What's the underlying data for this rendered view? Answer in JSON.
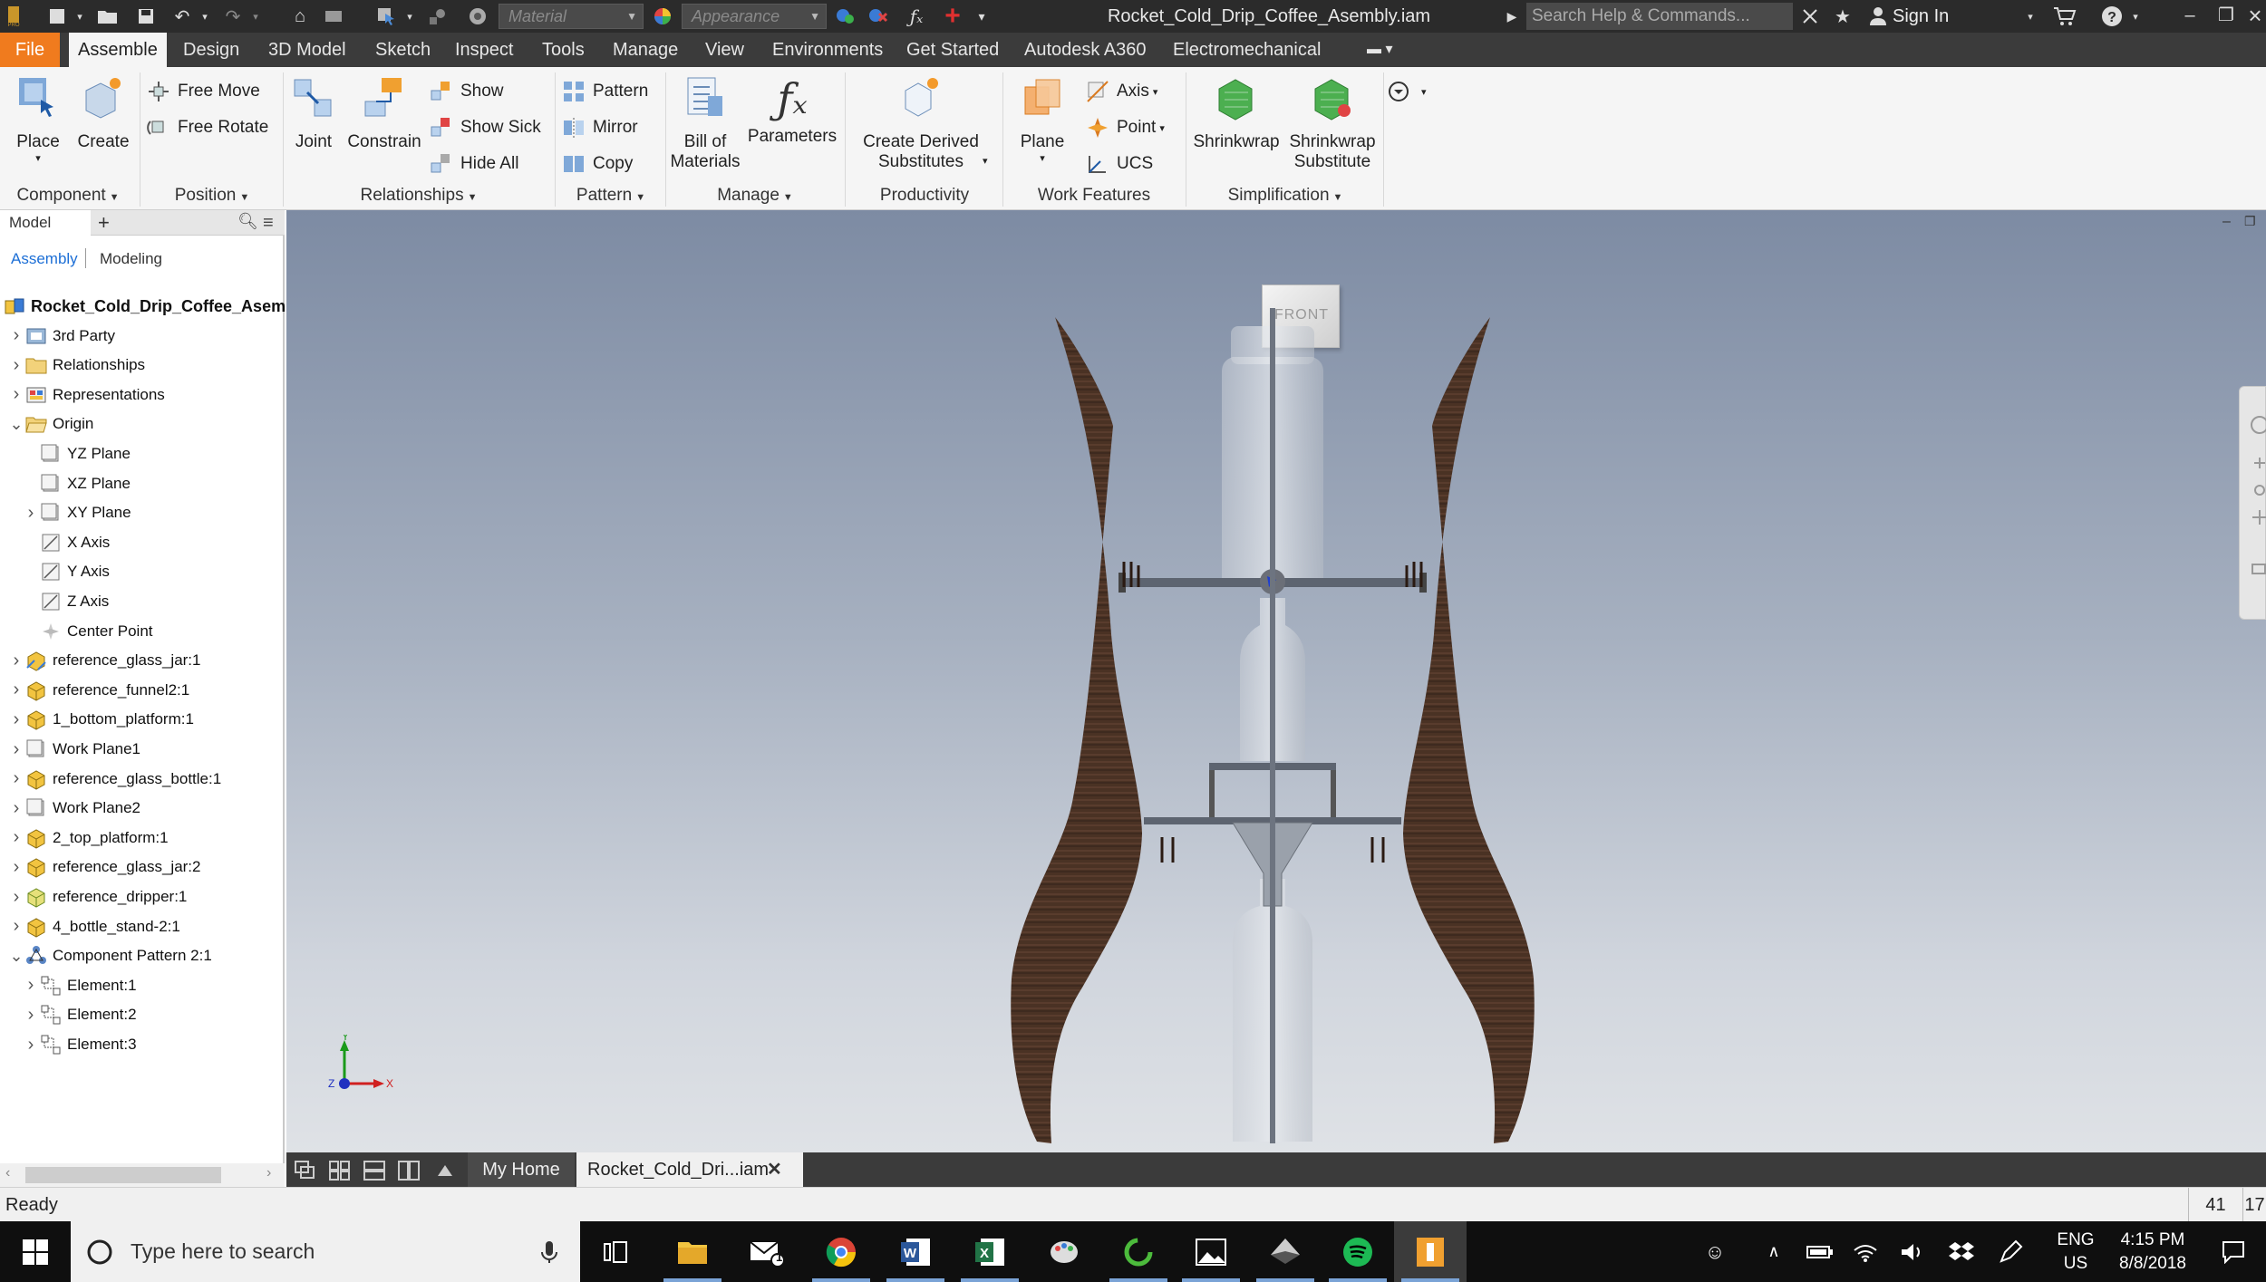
{
  "titlebar": {
    "document_title": "Rocket_Cold_Drip_Coffee_Asembly.iam",
    "material_placeholder": "Material",
    "appearance_placeholder": "Appearance",
    "search_placeholder": "Search Help & Commands...",
    "sign_in": "Sign In",
    "icons": [
      "new-icon",
      "open-icon",
      "save-icon",
      "undo-icon",
      "redo-icon",
      "home-icon",
      "return-icon",
      "select-icon",
      "update-icon",
      "color-wheel-icon",
      "adjust-icon",
      "clear-override-icon",
      "fx-icon",
      "add-icon",
      "customize-icon",
      "cart-icon",
      "help-icon",
      "minimize-icon",
      "restore-icon",
      "close-icon"
    ]
  },
  "menu": {
    "tabs": [
      "File",
      "Assemble",
      "Design",
      "3D Model",
      "Sketch",
      "Inspect",
      "Tools",
      "Manage",
      "View",
      "Environments",
      "Get Started",
      "Autodesk A360",
      "Electromechanical"
    ],
    "active": "Assemble"
  },
  "ribbon": {
    "component": {
      "label": "Component",
      "place": "Place",
      "create": "Create"
    },
    "position": {
      "label": "Position",
      "free_move": "Free Move",
      "free_rotate": "Free Rotate"
    },
    "relationships": {
      "label": "Relationships",
      "joint": "Joint",
      "constrain": "Constrain",
      "show": "Show",
      "show_sick": "Show Sick",
      "hide_all": "Hide All"
    },
    "pattern": {
      "label": "Pattern",
      "pattern": "Pattern",
      "mirror": "Mirror",
      "copy": "Copy"
    },
    "manage": {
      "label": "Manage",
      "bom_1": "Bill of",
      "bom_2": "Materials",
      "parameters": "Parameters"
    },
    "productivity": {
      "label": "Productivity",
      "derived_1": "Create Derived",
      "derived_2": "Substitutes"
    },
    "work_features": {
      "label": "Work Features",
      "plane": "Plane",
      "axis": "Axis",
      "point": "Point",
      "ucs": "UCS"
    },
    "simplification": {
      "label": "Simplification",
      "shrinkwrap": "Shrinkwrap",
      "shrinkwrap_sub_1": "Shrinkwrap",
      "shrinkwrap_sub_2": "Substitute"
    }
  },
  "browser": {
    "tab": "Model",
    "modes": [
      "Assembly",
      "Modeling"
    ],
    "tree": [
      {
        "label": "Rocket_Cold_Drip_Coffee_Asembly.iam",
        "indent": 0,
        "expander": "",
        "icon": "assembly-icon",
        "root": true
      },
      {
        "label": "3rd Party",
        "indent": 1,
        "expander": "collapsed",
        "icon": "third-party-icon"
      },
      {
        "label": "Relationships",
        "indent": 1,
        "expander": "collapsed",
        "icon": "folder-icon"
      },
      {
        "label": "Representations",
        "indent": 1,
        "expander": "collapsed",
        "icon": "representations-icon"
      },
      {
        "label": "Origin",
        "indent": 1,
        "expander": "expanded",
        "icon": "folder-open-icon"
      },
      {
        "label": "YZ Plane",
        "indent": 2,
        "expander": "",
        "icon": "plane-icon"
      },
      {
        "label": "XZ Plane",
        "indent": 2,
        "expander": "",
        "icon": "plane-icon"
      },
      {
        "label": "XY Plane",
        "indent": 2,
        "expander": "collapsed",
        "icon": "plane-icon"
      },
      {
        "label": "X Axis",
        "indent": 2,
        "expander": "",
        "icon": "axis-icon"
      },
      {
        "label": "Y Axis",
        "indent": 2,
        "expander": "",
        "icon": "axis-icon"
      },
      {
        "label": "Z Axis",
        "indent": 2,
        "expander": "",
        "icon": "axis-icon"
      },
      {
        "label": "Center Point",
        "indent": 2,
        "expander": "",
        "icon": "center-point-icon"
      },
      {
        "label": "reference_glass_jar:1",
        "indent": 1,
        "expander": "collapsed",
        "icon": "part-grounded-icon"
      },
      {
        "label": "reference_funnel2:1",
        "indent": 1,
        "expander": "collapsed",
        "icon": "part-icon"
      },
      {
        "label": "1_bottom_platform:1",
        "indent": 1,
        "expander": "collapsed",
        "icon": "part-icon"
      },
      {
        "label": "Work Plane1",
        "indent": 1,
        "expander": "collapsed",
        "icon": "work-plane-icon"
      },
      {
        "label": "reference_glass_bottle:1",
        "indent": 1,
        "expander": "collapsed",
        "icon": "part-icon"
      },
      {
        "label": "Work Plane2",
        "indent": 1,
        "expander": "collapsed",
        "icon": "work-plane-icon"
      },
      {
        "label": "2_top_platform:1",
        "indent": 1,
        "expander": "collapsed",
        "icon": "part-icon"
      },
      {
        "label": "reference_glass_jar:2",
        "indent": 1,
        "expander": "collapsed",
        "icon": "part-icon"
      },
      {
        "label": "reference_dripper:1",
        "indent": 1,
        "expander": "collapsed",
        "icon": "part-green-icon"
      },
      {
        "label": "4_bottle_stand-2:1",
        "indent": 1,
        "expander": "collapsed",
        "icon": "part-icon"
      },
      {
        "label": "Component Pattern 2:1",
        "indent": 1,
        "expander": "expanded",
        "icon": "component-pattern-icon"
      },
      {
        "label": "Element:1",
        "indent": 2,
        "expander": "collapsed",
        "icon": "element-icon"
      },
      {
        "label": "Element:2",
        "indent": 2,
        "expander": "collapsed",
        "icon": "element-icon"
      },
      {
        "label": "Element:3",
        "indent": 2,
        "expander": "collapsed",
        "icon": "element-icon"
      }
    ]
  },
  "viewport": {
    "viewcube_label": "FRONT",
    "triad": {
      "x": "X",
      "y": "Y",
      "z": "Z"
    }
  },
  "doc_tabs": {
    "home": "My Home",
    "document": "Rocket_Cold_Dri...iam",
    "close": "✕"
  },
  "status": {
    "text": "Ready",
    "n1": "41",
    "n2": "17"
  },
  "taskbar": {
    "search_placeholder": "Type here to search",
    "language_1": "ENG",
    "language_2": "US",
    "time": "4:15 PM",
    "date": "8/8/2018",
    "mail_badge": "1"
  },
  "colors": {
    "accent_orange": "#f07b1e",
    "title_bar": "#2b2b2b",
    "menu_bar": "#3b3b3b",
    "ribbon_bg": "#f5f5f5",
    "link_blue": "#1d6fd6",
    "wood": "#4a3224"
  }
}
